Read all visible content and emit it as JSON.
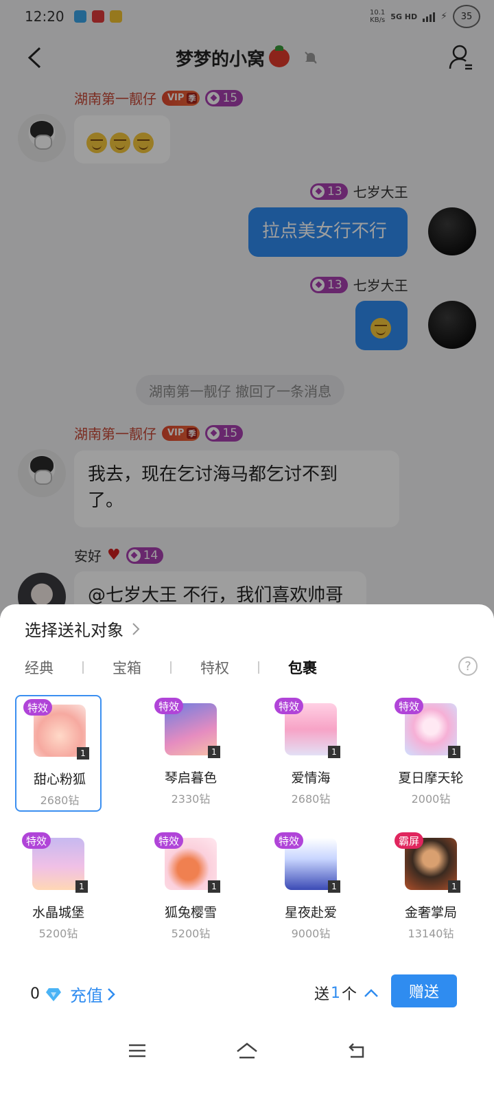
{
  "status_bar": {
    "time": "12:20",
    "net_speed_value": "10.1",
    "net_speed_unit": "KB/s",
    "network_label": "5G HD",
    "battery": "35"
  },
  "header": {
    "title": "梦梦的小窝"
  },
  "messages": [
    {
      "sender": "湖南第一靓仔",
      "vip": "VIP",
      "season": "季",
      "level": "15",
      "emoji_count": 3
    },
    {
      "sender": "七岁大王",
      "level": "13",
      "text": "拉点美女行不行"
    },
    {
      "sender": "七岁大王",
      "level": "13",
      "emoji_count": 1
    },
    {
      "sender": "湖南第一靓仔",
      "vip": "VIP",
      "season": "季",
      "level": "15",
      "text_line1": "我去，现在乞讨海马都乞讨不到",
      "text_line2": "了。"
    },
    {
      "sender": "安好",
      "level": "14",
      "text": "@七岁大王 不行，我们喜欢帅哥"
    }
  ],
  "recall_notice": "湖南第一靓仔 撤回了一条消息",
  "gift_sheet": {
    "title": "选择送礼对象",
    "tabs": [
      "经典",
      "宝箱",
      "特权",
      "包裹"
    ],
    "active_tab": "包裹",
    "help": "?",
    "gifts": [
      {
        "tag": "特效",
        "name": "甜心粉狐",
        "price": "2680钻",
        "count": "1",
        "selected": true
      },
      {
        "tag": "特效",
        "name": "琴启暮色",
        "price": "2330钻",
        "count": "1"
      },
      {
        "tag": "特效",
        "name": "爱情海",
        "price": "2680钻",
        "count": "1"
      },
      {
        "tag": "特效",
        "name": "夏日摩天轮",
        "price": "2000钻",
        "count": "1"
      },
      {
        "tag": "特效",
        "name": "水晶城堡",
        "price": "5200钻",
        "count": "1"
      },
      {
        "tag": "特效",
        "name": "狐兔樱雪",
        "price": "5200钻",
        "count": "1"
      },
      {
        "tag": "特效",
        "name": "星夜赴爱",
        "price": "9000钻",
        "count": "1"
      },
      {
        "tag": "霸屏",
        "name": "金奢掌局",
        "price": "13140钻",
        "count": "1"
      }
    ],
    "balance": "0",
    "recharge": "充值",
    "send_prefix": "送",
    "send_qty": "1",
    "send_suffix": "个",
    "send_button": "赠送"
  },
  "colors": {
    "accent": "#2f8cf0",
    "vip": "#e0482e",
    "level": "#a93fb0",
    "effect_tag": "#b044d8",
    "screen_tag": "#e0265e"
  }
}
